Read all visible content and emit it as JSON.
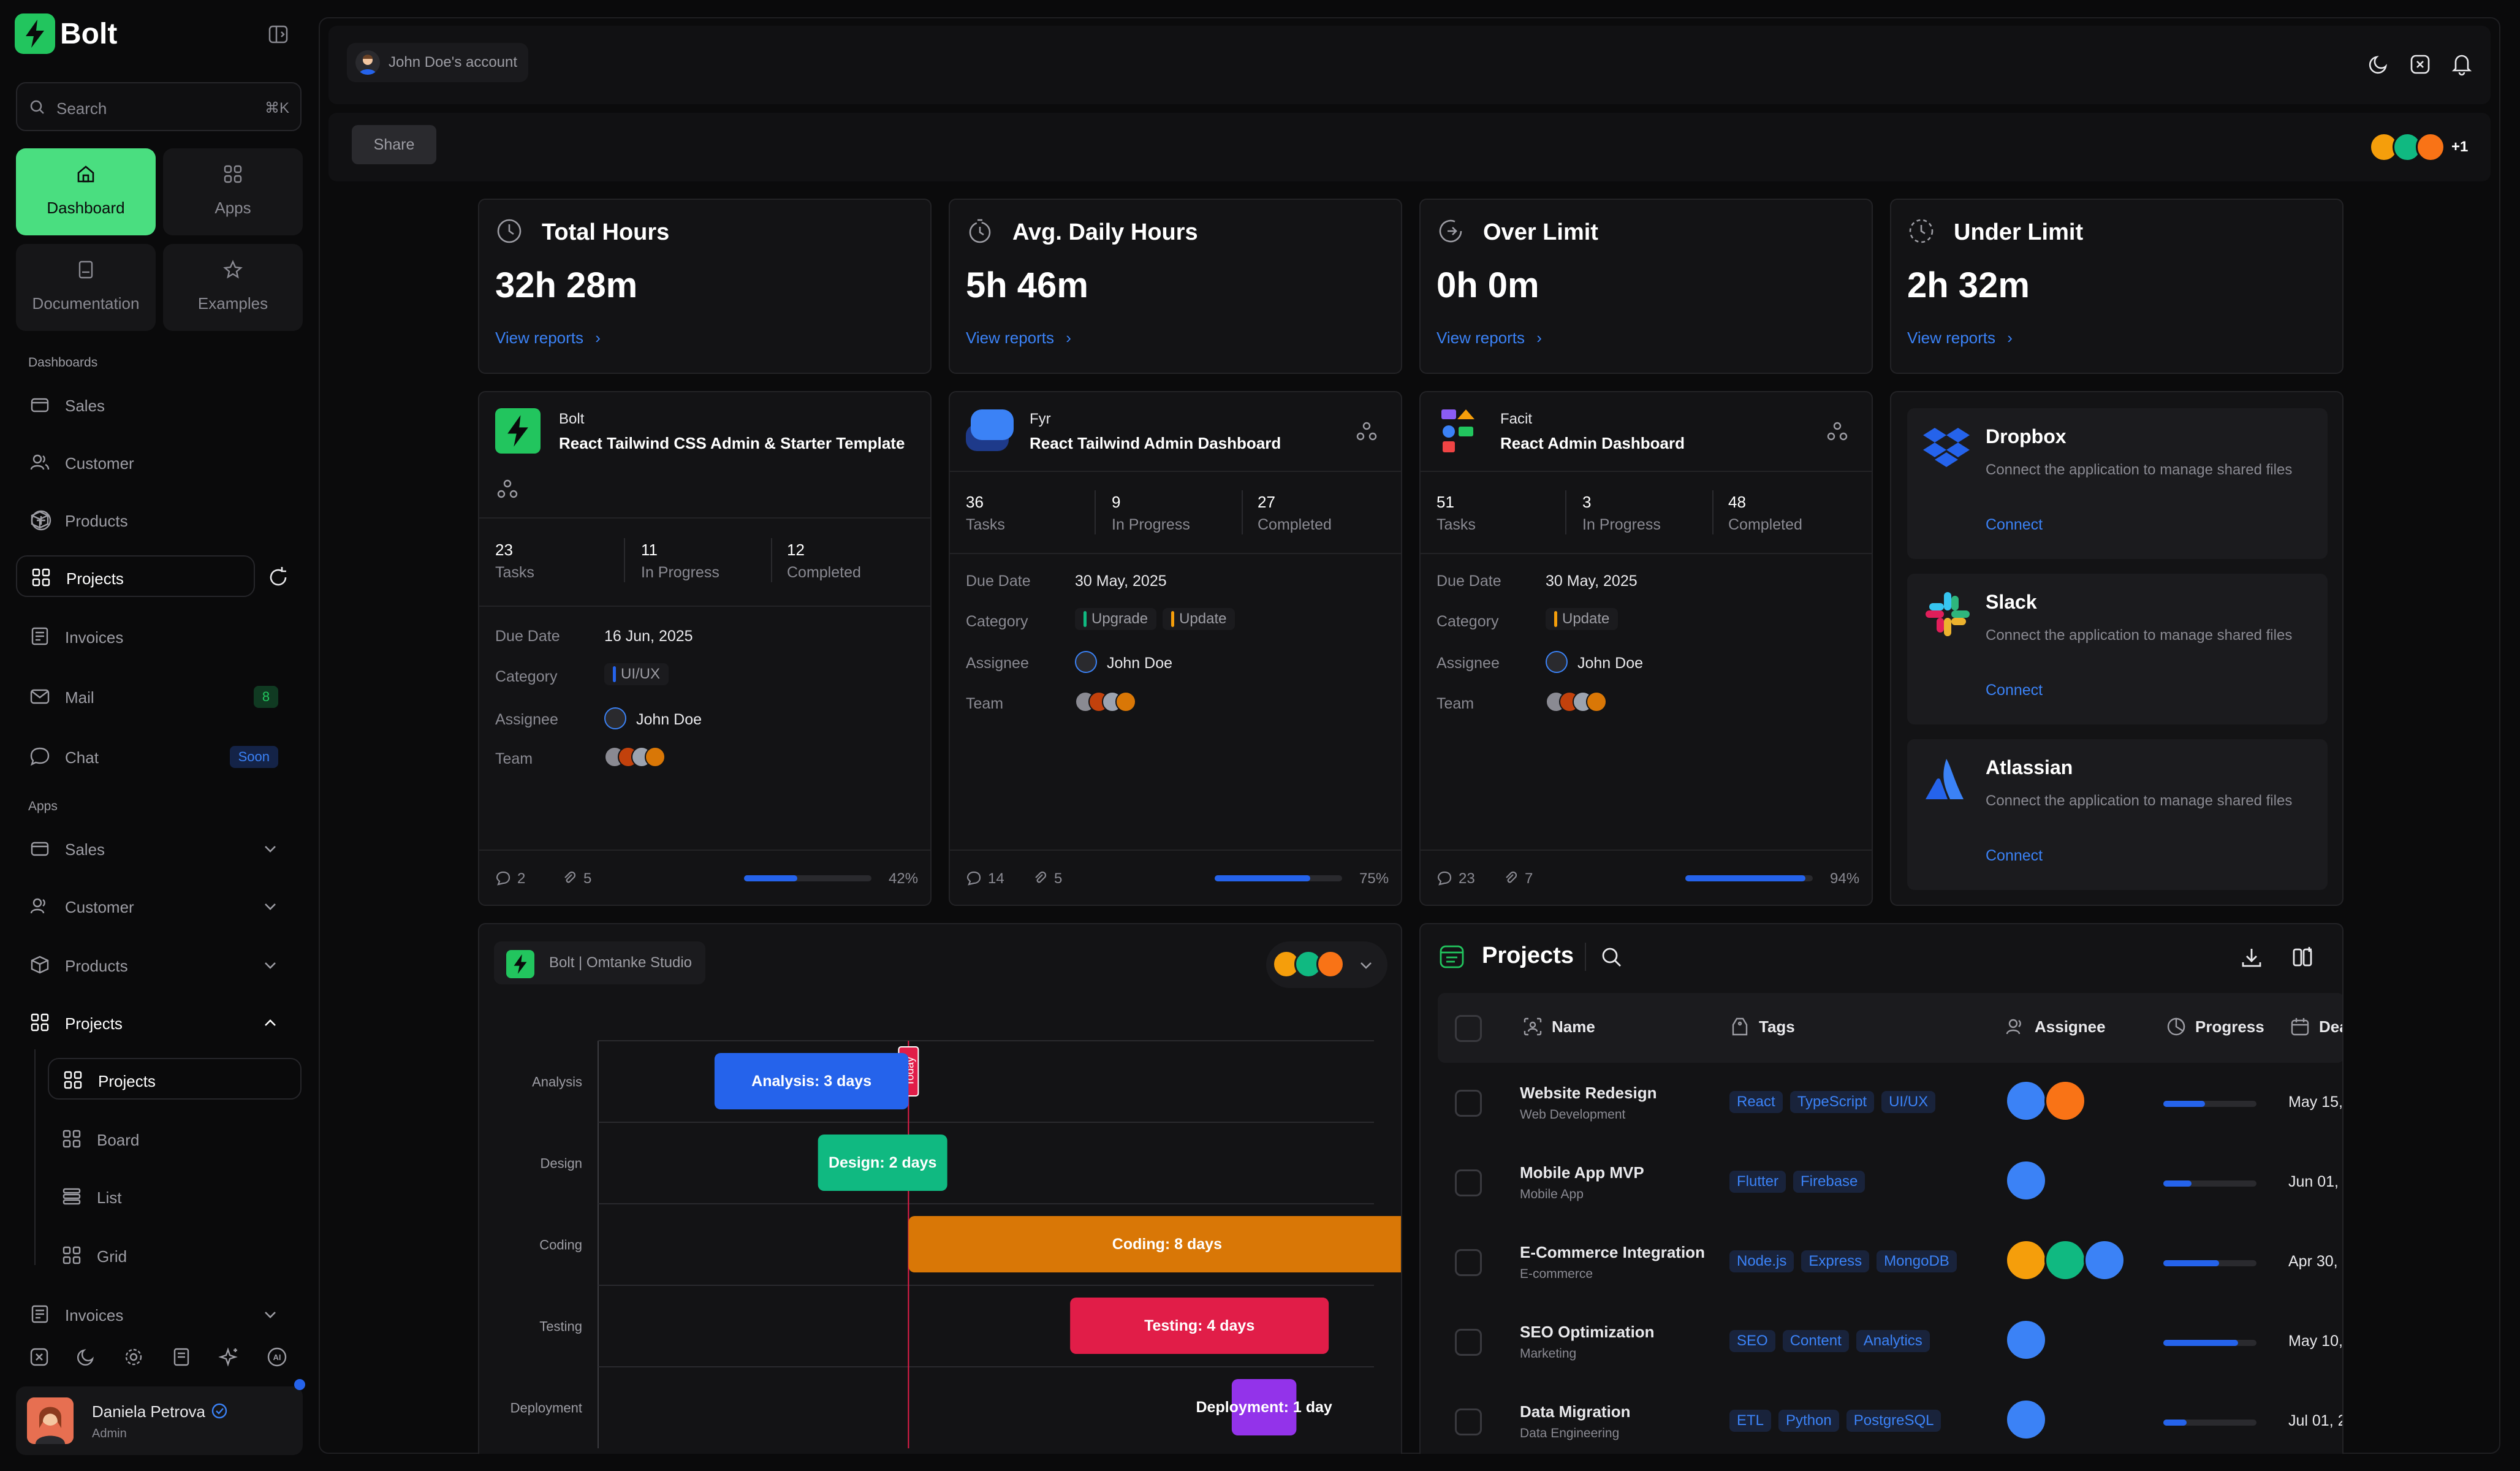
{
  "app": {
    "name": "Bolt"
  },
  "search": {
    "placeholder": "Search",
    "shortcut": "⌘K"
  },
  "quick_tiles": [
    {
      "label": "Dashboard",
      "icon": "home-icon",
      "active": true
    },
    {
      "label": "Apps",
      "icon": "grid-icon"
    },
    {
      "label": "Documentation",
      "icon": "document-icon"
    },
    {
      "label": "Examples",
      "icon": "star-icon"
    }
  ],
  "sidebar": {
    "dashboards_title": "Dashboards",
    "dashboards": [
      {
        "label": "Sales",
        "icon": "sales-icon"
      },
      {
        "label": "Customer",
        "icon": "users-icon"
      },
      {
        "label": "Products",
        "icon": "box-icon",
        "action_icon": "plus-circle-icon"
      },
      {
        "label": "Projects",
        "icon": "grid-icon",
        "active": true,
        "action_icon": "refresh-icon"
      },
      {
        "label": "Invoices",
        "icon": "invoice-icon"
      },
      {
        "label": "Mail",
        "icon": "mail-icon",
        "badge": "8"
      },
      {
        "label": "Chat",
        "icon": "chat-icon",
        "badge": "Soon"
      }
    ],
    "apps_title": "Apps",
    "apps": [
      {
        "label": "Sales",
        "icon": "sales-icon"
      },
      {
        "label": "Customer",
        "icon": "users-icon"
      },
      {
        "label": "Products",
        "icon": "box-icon"
      },
      {
        "label": "Projects",
        "icon": "grid-icon",
        "expanded": true
      },
      {
        "label": "Invoices",
        "icon": "invoice-icon"
      }
    ],
    "project_sub": [
      {
        "label": "Projects",
        "icon": "grid-icon",
        "active": true
      },
      {
        "label": "Board",
        "icon": "grid-icon"
      },
      {
        "label": "List",
        "icon": "list-icon"
      },
      {
        "label": "Grid",
        "icon": "grid-icon"
      }
    ],
    "user": {
      "name": "Daniela Petrova",
      "role": "Admin"
    }
  },
  "topbar": {
    "account": "John Doe's account"
  },
  "share": {
    "label": "Share",
    "more_count": "+1"
  },
  "stats": [
    {
      "title": "Total Hours",
      "value": "32h 28m",
      "link": "View reports",
      "icon": "clock-icon"
    },
    {
      "title": "Avg. Daily Hours",
      "value": "5h 46m",
      "link": "View reports",
      "icon": "timer-icon"
    },
    {
      "title": "Over Limit",
      "value": "0h 0m",
      "link": "View reports",
      "icon": "arrow-circle-icon"
    },
    {
      "title": "Under Limit",
      "value": "2h 32m",
      "link": "View reports",
      "icon": "dashed-clock-icon"
    }
  ],
  "projects_cards": [
    {
      "company": "Bolt",
      "title": "React Tailwind CSS Admin & Starter Template",
      "tasks": "23",
      "in_progress": "11",
      "completed": "12",
      "due_date": "16 Jun, 2025",
      "categories": [
        {
          "label": "UI/UX",
          "color": "#2563eb"
        }
      ],
      "assignee": "John Doe",
      "comments": "2",
      "attachments": "5",
      "progress": 42,
      "progress_label": "42%"
    },
    {
      "company": "Fyr",
      "title": "React Tailwind Admin Dashboard",
      "tasks": "36",
      "in_progress": "9",
      "completed": "27",
      "due_date": "30 May, 2025",
      "categories": [
        {
          "label": "Upgrade",
          "color": "#10b981"
        },
        {
          "label": "Update",
          "color": "#f59e0b"
        }
      ],
      "assignee": "John Doe",
      "comments": "14",
      "attachments": "5",
      "progress": 75,
      "progress_label": "75%"
    },
    {
      "company": "Facit",
      "title": "React Admin Dashboard",
      "tasks": "51",
      "in_progress": "3",
      "completed": "48",
      "due_date": "30 May, 2025",
      "categories": [
        {
          "label": "Update",
          "color": "#f59e0b"
        }
      ],
      "assignee": "John Doe",
      "comments": "23",
      "attachments": "7",
      "progress": 94,
      "progress_label": "94%"
    }
  ],
  "card_labels": {
    "tasks": "Tasks",
    "in_progress": "In Progress",
    "completed": "Completed",
    "due_date": "Due Date",
    "category": "Category",
    "assignee": "Assignee",
    "team": "Team"
  },
  "integrations": [
    {
      "name": "Dropbox",
      "desc": "Connect the application to manage shared files",
      "link": "Connect",
      "icon": "dropbox-icon"
    },
    {
      "name": "Slack",
      "desc": "Connect the application to manage shared files",
      "link": "Connect",
      "icon": "slack-icon"
    },
    {
      "name": "Atlassian",
      "desc": "Connect the application to manage shared files",
      "link": "Connect",
      "icon": "atlassian-icon"
    }
  ],
  "gantt": {
    "workspace": "Bolt | Omtanke Studio",
    "today_label": "Today",
    "chart_data": {
      "type": "gantt",
      "categories": [
        "Analysis",
        "Design",
        "Coding",
        "Testing",
        "Deployment"
      ],
      "tasks": [
        {
          "category": "Analysis",
          "label": "Analysis: 3 days",
          "start": 1.8,
          "duration": 3,
          "color": "#2563eb"
        },
        {
          "category": "Design",
          "label": "Design: 2 days",
          "start": 3.4,
          "duration": 2,
          "color": "#10b981"
        },
        {
          "category": "Coding",
          "label": "Coding: 8 days",
          "start": 4.8,
          "duration": 8,
          "color": "#d97706"
        },
        {
          "category": "Testing",
          "label": "Testing: 4 days",
          "start": 7.3,
          "duration": 4,
          "color": "#e11d48"
        },
        {
          "category": "Deployment",
          "label": "Deployment: 1 day",
          "start": 9.8,
          "duration": 1,
          "color": "#9333ea"
        }
      ],
      "today": 4.8,
      "xlim": [
        0,
        12
      ]
    }
  },
  "table": {
    "title": "Projects",
    "columns": [
      "Name",
      "Tags",
      "Assignee",
      "Progress",
      "Dea"
    ],
    "rows": [
      {
        "name": "Website Redesign",
        "sub": "Web Development",
        "tags": [
          "React",
          "TypeScript",
          "UI/UX"
        ],
        "assignees": 2,
        "progress": 45,
        "date": "May 15, 2"
      },
      {
        "name": "Mobile App MVP",
        "sub": "Mobile App",
        "tags": [
          "Flutter",
          "Firebase"
        ],
        "assignees": 1,
        "progress": 30,
        "date": "Jun 01, 2"
      },
      {
        "name": "E-Commerce Integration",
        "sub": "E-commerce",
        "tags": [
          "Node.js",
          "Express",
          "MongoDB"
        ],
        "assignees": 3,
        "progress": 60,
        "date": "Apr 30, 2"
      },
      {
        "name": "SEO Optimization",
        "sub": "Marketing",
        "tags": [
          "SEO",
          "Content",
          "Analytics"
        ],
        "assignees": 1,
        "progress": 80,
        "date": "May 10, 2"
      },
      {
        "name": "Data Migration",
        "sub": "Data Engineering",
        "tags": [
          "ETL",
          "Python",
          "PostgreSQL"
        ],
        "assignees": 1,
        "progress": 25,
        "date": "Jul 01, 20"
      }
    ]
  },
  "colors": {
    "brand": "#22c55e",
    "accent": "#3b82f6",
    "bg": "#0a0a0b",
    "panel": "#131315"
  }
}
